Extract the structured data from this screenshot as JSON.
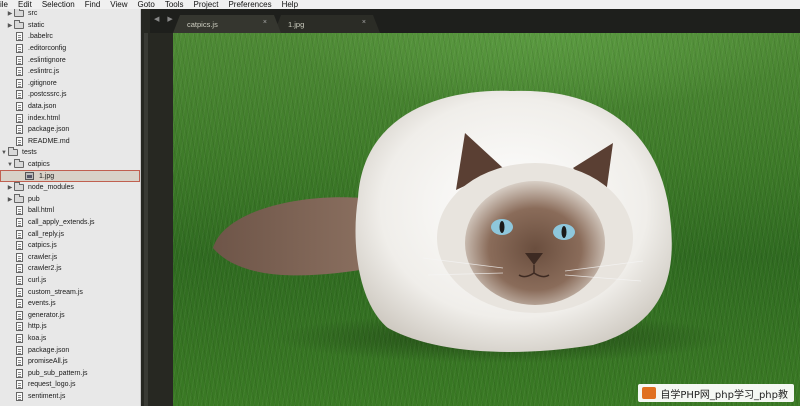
{
  "menu": [
    "ile",
    "Edit",
    "Selection",
    "Find",
    "View",
    "Goto",
    "Tools",
    "Project",
    "Preferences",
    "Help"
  ],
  "sidebar": {
    "items": [
      {
        "label": "src",
        "type": "folder",
        "indent": 0,
        "state": "collapsed"
      },
      {
        "label": "static",
        "type": "folder",
        "indent": 0,
        "state": "collapsed"
      },
      {
        "label": ".babelrc",
        "type": "file",
        "indent": 0
      },
      {
        "label": ".editorconfig",
        "type": "file",
        "indent": 0
      },
      {
        "label": ".eslintignore",
        "type": "file",
        "indent": 0
      },
      {
        "label": ".eslintrc.js",
        "type": "file",
        "indent": 0
      },
      {
        "label": ".gitignore",
        "type": "file",
        "indent": 0
      },
      {
        "label": ".postcssrc.js",
        "type": "file",
        "indent": 0
      },
      {
        "label": "data.json",
        "type": "file",
        "indent": 0
      },
      {
        "label": "index.html",
        "type": "file",
        "indent": 0
      },
      {
        "label": "package.json",
        "type": "file",
        "indent": 0
      },
      {
        "label": "README.md",
        "type": "file",
        "indent": 0
      },
      {
        "label": "tests",
        "type": "folder",
        "indent": -1,
        "state": "expanded"
      },
      {
        "label": "catpics",
        "type": "folder",
        "indent": 0,
        "state": "expanded"
      },
      {
        "label": "1.jpg",
        "type": "image",
        "indent": 1,
        "selected": true
      },
      {
        "label": "node_modules",
        "type": "folder",
        "indent": 0,
        "state": "collapsed"
      },
      {
        "label": "pub",
        "type": "folder",
        "indent": 0,
        "state": "collapsed"
      },
      {
        "label": "ball.html",
        "type": "file",
        "indent": 0
      },
      {
        "label": "call_apply_extends.js",
        "type": "file",
        "indent": 0
      },
      {
        "label": "call_reply.js",
        "type": "file",
        "indent": 0
      },
      {
        "label": "catpics.js",
        "type": "file",
        "indent": 0
      },
      {
        "label": "crawler.js",
        "type": "file",
        "indent": 0
      },
      {
        "label": "crawler2.js",
        "type": "file",
        "indent": 0
      },
      {
        "label": "curl.js",
        "type": "file",
        "indent": 0
      },
      {
        "label": "custom_stream.js",
        "type": "file",
        "indent": 0
      },
      {
        "label": "events.js",
        "type": "file",
        "indent": 0
      },
      {
        "label": "generator.js",
        "type": "file",
        "indent": 0
      },
      {
        "label": "http.js",
        "type": "file",
        "indent": 0
      },
      {
        "label": "koa.js",
        "type": "file",
        "indent": 0
      },
      {
        "label": "package.json",
        "type": "file",
        "indent": 0
      },
      {
        "label": "promiseAll.js",
        "type": "file",
        "indent": 0
      },
      {
        "label": "pub_sub_pattern.js",
        "type": "file",
        "indent": 0
      },
      {
        "label": "request_logo.js",
        "type": "file",
        "indent": 0
      },
      {
        "label": "sentiment.js",
        "type": "file",
        "indent": 0
      }
    ]
  },
  "tabs": [
    {
      "label": "catpics.js",
      "close": "×",
      "active": true
    },
    {
      "label": "1.jpg",
      "close": "×",
      "active": false
    }
  ],
  "tab_nav": "◀ ▶",
  "watermark": "自学PHP网_php学习_php教",
  "viewer": {
    "image": "photo-of-white-cat-on-grass"
  }
}
